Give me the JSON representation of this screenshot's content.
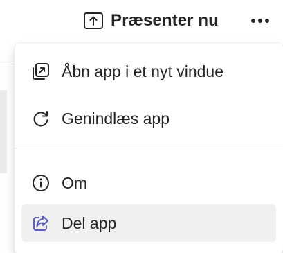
{
  "toolbar": {
    "present_label": "Præsenter nu",
    "present_icon": "share-screen-icon",
    "more_icon": "more-horizontal-icon"
  },
  "menu": {
    "items": [
      {
        "label": "Åbn app i et nyt vindue",
        "icon": "open-in-new-window-icon"
      },
      {
        "label": "Genindlæs app",
        "icon": "reload-icon"
      },
      {
        "label": "Om",
        "icon": "info-icon"
      },
      {
        "label": "Del app",
        "icon": "share-icon"
      }
    ]
  },
  "colors": {
    "text": "#242424",
    "accent": "#5b5fc7",
    "hover_bg": "#f0f0f0",
    "divider": "#e0e0e0"
  }
}
